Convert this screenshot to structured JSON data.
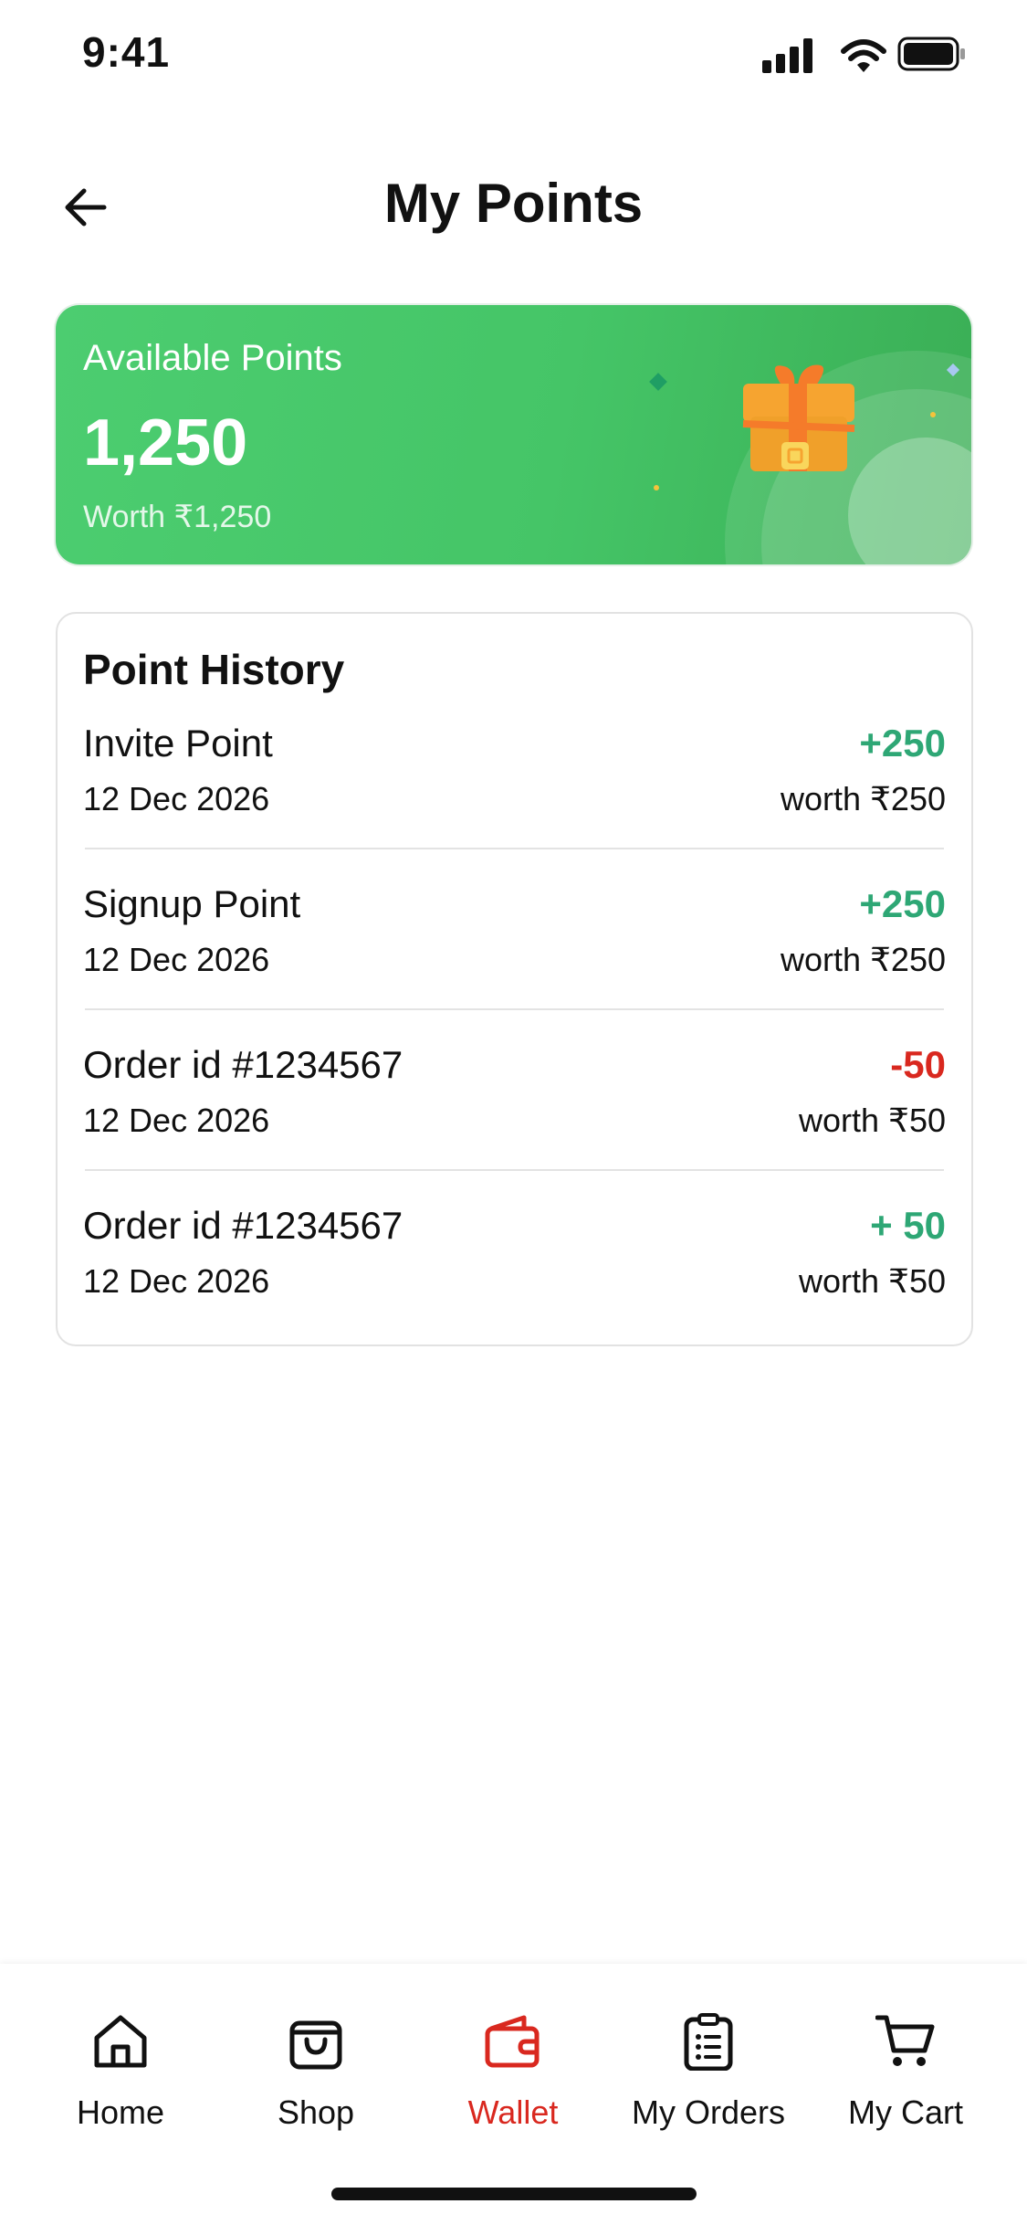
{
  "status_bar": {
    "time": "9:41",
    "icons": [
      "signal-icon",
      "wifi-icon",
      "battery-icon"
    ]
  },
  "header": {
    "title": "My Points",
    "back_icon": "arrow-left-icon"
  },
  "points_card": {
    "label": "Available Points",
    "points": "1,250",
    "worth": "Worth ₹1,250",
    "illustration": "gift-box-icon",
    "colors": {
      "start": "#4ccd70",
      "end": "#3aae55"
    }
  },
  "history": {
    "title": "Point History",
    "items": [
      {
        "title": "Invite Point",
        "date": "12 Dec 2026",
        "amount": "+250",
        "worth": "worth ₹250",
        "type": "credit"
      },
      {
        "title": "Signup Point",
        "date": "12 Dec 2026",
        "amount": "+250",
        "worth": "worth ₹250",
        "type": "credit"
      },
      {
        "title": "Order id #1234567",
        "date": "12 Dec 2026",
        "amount": "-50",
        "worth": "worth ₹50",
        "type": "debit"
      },
      {
        "title": "Order id #1234567",
        "date": "12 Dec 2026",
        "amount": "+ 50",
        "worth": "worth ₹50",
        "type": "credit"
      }
    ],
    "colors": {
      "credit": "#2ea775",
      "debit": "#d9281f"
    }
  },
  "bottom_nav": {
    "items": [
      {
        "label": "Home",
        "icon": "home-icon",
        "active": false
      },
      {
        "label": "Shop",
        "icon": "shopping-bag-icon",
        "active": false
      },
      {
        "label": "Wallet",
        "icon": "wallet-icon",
        "active": true
      },
      {
        "label": "My Orders",
        "icon": "clipboard-list-icon",
        "active": false
      },
      {
        "label": "My Cart",
        "icon": "cart-icon",
        "active": false
      }
    ],
    "colors": {
      "active": "#d9281f",
      "inactive": "#111111"
    }
  }
}
